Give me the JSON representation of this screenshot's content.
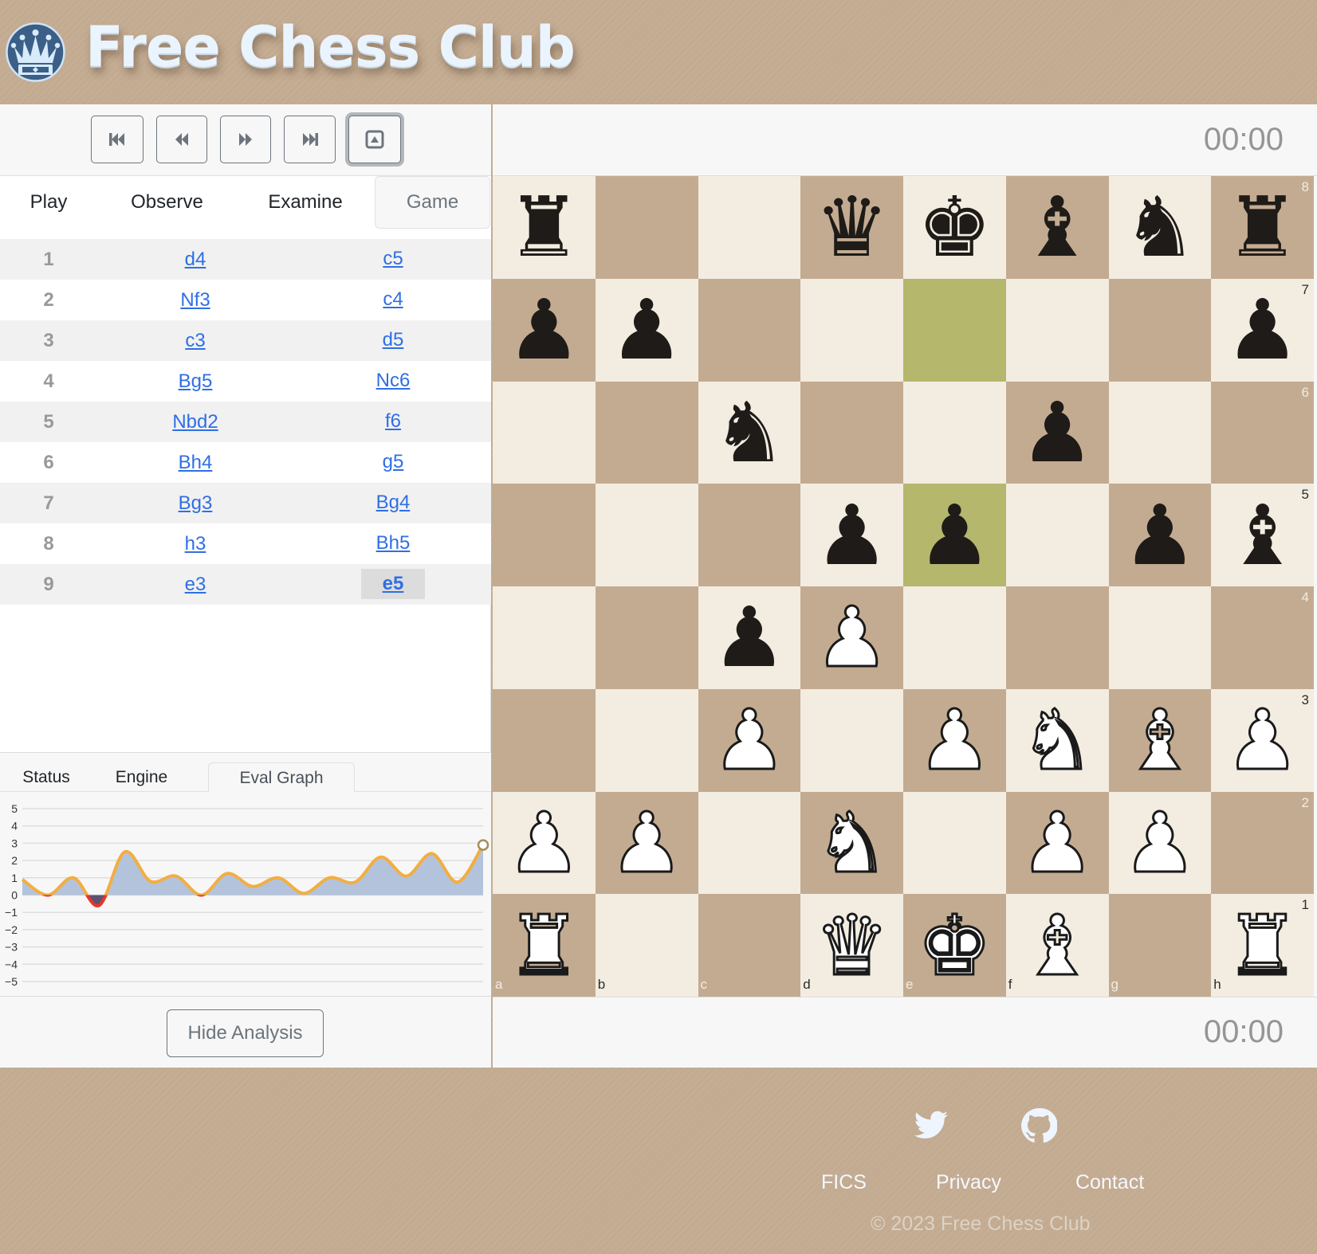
{
  "header": {
    "title": "Free Chess Club",
    "logo_icon": "crown-logo-icon"
  },
  "toolbar": {
    "buttons": [
      {
        "name": "first-move-button",
        "icon": "skip-to-start-icon"
      },
      {
        "name": "previous-move-button",
        "icon": "rewind-icon"
      },
      {
        "name": "next-move-button",
        "icon": "fast-forward-icon"
      },
      {
        "name": "last-move-button",
        "icon": "skip-to-end-icon"
      },
      {
        "name": "flip-board-button",
        "icon": "eject-icon"
      }
    ]
  },
  "tabs": [
    {
      "label": "Play",
      "active": false
    },
    {
      "label": "Observe",
      "active": false
    },
    {
      "label": "Examine",
      "active": false
    },
    {
      "label": "Game",
      "active": true
    }
  ],
  "moves": [
    {
      "num": "1",
      "white": "d4",
      "black": "c5"
    },
    {
      "num": "2",
      "white": "Nf3",
      "black": "c4"
    },
    {
      "num": "3",
      "white": "c3",
      "black": "d5"
    },
    {
      "num": "4",
      "white": "Bg5",
      "black": "Nc6"
    },
    {
      "num": "5",
      "white": "Nbd2",
      "black": "f6"
    },
    {
      "num": "6",
      "white": "Bh4",
      "black": "g5"
    },
    {
      "num": "7",
      "white": "Bg3",
      "black": "Bg4"
    },
    {
      "num": "8",
      "white": "h3",
      "black": "Bh5"
    },
    {
      "num": "9",
      "white": "e3",
      "black": "e5"
    }
  ],
  "current_move": "9... e5",
  "bottom_tabs": [
    {
      "label": "Status",
      "active": false
    },
    {
      "label": "Engine",
      "active": false
    },
    {
      "label": "Eval Graph",
      "active": true
    }
  ],
  "chart_data": {
    "type": "area",
    "title": "Eval Graph",
    "xlabel": "",
    "ylabel": "",
    "x": [
      0,
      1,
      2,
      3,
      4,
      5,
      6,
      7,
      8,
      9,
      10,
      11,
      12,
      13,
      14,
      15,
      16,
      17,
      18
    ],
    "series": [
      {
        "name": "evaluation",
        "values": [
          0.9,
          0.0,
          1.0,
          -0.6,
          2.5,
          0.8,
          1.1,
          0.0,
          1.25,
          0.5,
          1.0,
          0.1,
          1.0,
          0.75,
          2.2,
          1.1,
          2.4,
          0.75,
          2.9
        ]
      }
    ],
    "ylim": [
      -5,
      5
    ],
    "yticks": [
      "5",
      "4",
      "3",
      "2",
      "1",
      "0",
      "−1",
      "−2",
      "−3",
      "−4",
      "−5"
    ],
    "grid": true,
    "colors": {
      "line": "#f2ae42",
      "positive_fill": "#b3c3dc",
      "negative_line": "#e8352a",
      "negative_fill": "#5e5270",
      "marker": "#a48f5a"
    }
  },
  "analysis": {
    "hide_label": "Hide Analysis"
  },
  "clocks": {
    "top": "00:00",
    "bottom": "00:00"
  },
  "board": {
    "orientation": "white",
    "files": [
      "a",
      "b",
      "c",
      "d",
      "e",
      "f",
      "g",
      "h"
    ],
    "ranks": [
      "8",
      "7",
      "6",
      "5",
      "4",
      "3",
      "2",
      "1"
    ],
    "position": [
      [
        "r",
        "",
        "",
        "q",
        "k",
        "b",
        "n",
        "r"
      ],
      [
        "p",
        "p",
        "",
        "",
        "",
        "",
        "",
        "p"
      ],
      [
        "",
        "",
        "n",
        "",
        "",
        "p",
        "",
        ""
      ],
      [
        "",
        "",
        "",
        "p",
        "p",
        "",
        "p",
        "b"
      ],
      [
        "",
        "",
        "p",
        "P",
        "",
        "",
        "",
        ""
      ],
      [
        "",
        "",
        "P",
        "",
        "P",
        "N",
        "B",
        "P"
      ],
      [
        "P",
        "P",
        "",
        "N",
        "",
        "P",
        "P",
        ""
      ],
      [
        "R",
        "",
        "",
        "Q",
        "K",
        "B",
        "",
        "R"
      ]
    ],
    "highlighted_squares": [
      "e7",
      "e5"
    ],
    "colors": {
      "light": "#f3ece1",
      "dark": "#c3ab91",
      "highlight": "#b5b76c"
    }
  },
  "footer": {
    "social": [
      {
        "name": "twitter",
        "icon": "twitter-icon"
      },
      {
        "name": "github",
        "icon": "github-icon"
      }
    ],
    "links": [
      "FICS",
      "Privacy",
      "Contact"
    ],
    "copyright": "© 2023 Free Chess Club"
  },
  "colors": {
    "accent_link": "#2f6fe4",
    "background": "#c3ab91"
  }
}
